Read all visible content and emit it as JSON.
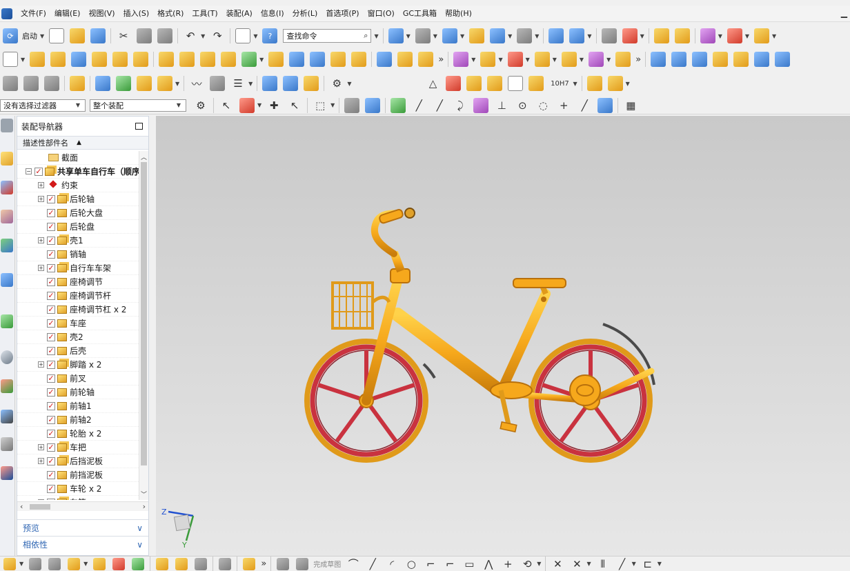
{
  "menubar": {
    "items": [
      "文件(F)",
      "编辑(E)",
      "视图(V)",
      "插入(S)",
      "格式(R)",
      "工具(T)",
      "装配(A)",
      "信息(I)",
      "分析(L)",
      "首选项(P)",
      "窗口(O)",
      "GC工具箱",
      "帮助(H)"
    ]
  },
  "toolbar": {
    "start_label": "启动",
    "search_placeholder": "查找命令",
    "filter_label": "没有选择过滤器",
    "assembly_scope": "整个装配",
    "fit_label": "10H7"
  },
  "navigator": {
    "title": "装配导航器",
    "column_header": "描述性部件名",
    "rows": [
      {
        "label": "截面",
        "type": "folder",
        "indent": 1,
        "expand": false,
        "checked": false
      },
      {
        "label": "共享单车自行车（顺序",
        "type": "asm",
        "indent": 0,
        "expand": true,
        "expanded": true,
        "checked": true,
        "bold": true
      },
      {
        "label": "约束",
        "type": "constraint",
        "indent": 1,
        "expand": true,
        "checked": false
      },
      {
        "label": "后轮轴",
        "type": "asm",
        "indent": 1,
        "expand": true,
        "checked": true
      },
      {
        "label": "后轮大盘",
        "type": "comp",
        "indent": 1,
        "expand": false,
        "checked": true
      },
      {
        "label": "后轮盘",
        "type": "comp",
        "indent": 1,
        "expand": false,
        "checked": true
      },
      {
        "label": "壳1",
        "type": "asm",
        "indent": 1,
        "expand": true,
        "checked": true
      },
      {
        "label": "销轴",
        "type": "comp",
        "indent": 1,
        "expand": false,
        "checked": true
      },
      {
        "label": "自行车车架",
        "type": "asm",
        "indent": 1,
        "expand": true,
        "checked": true
      },
      {
        "label": "座椅调节",
        "type": "comp",
        "indent": 1,
        "expand": false,
        "checked": true
      },
      {
        "label": "座椅调节杆",
        "type": "comp",
        "indent": 1,
        "expand": false,
        "checked": true
      },
      {
        "label": "座椅调节杠 x 2",
        "type": "comp",
        "indent": 1,
        "expand": false,
        "checked": true
      },
      {
        "label": "车座",
        "type": "comp",
        "indent": 1,
        "expand": false,
        "checked": true
      },
      {
        "label": "壳2",
        "type": "comp",
        "indent": 1,
        "expand": false,
        "checked": true
      },
      {
        "label": "后壳",
        "type": "comp",
        "indent": 1,
        "expand": false,
        "checked": true
      },
      {
        "label": "脚踏 x 2",
        "type": "asm",
        "indent": 1,
        "expand": true,
        "checked": true
      },
      {
        "label": "前叉",
        "type": "comp",
        "indent": 1,
        "expand": false,
        "checked": true
      },
      {
        "label": "前轮轴",
        "type": "comp",
        "indent": 1,
        "expand": false,
        "checked": true
      },
      {
        "label": "前轴1",
        "type": "comp",
        "indent": 1,
        "expand": false,
        "checked": true
      },
      {
        "label": "前轴2",
        "type": "comp",
        "indent": 1,
        "expand": false,
        "checked": true
      },
      {
        "label": "轮胎 x 2",
        "type": "comp",
        "indent": 1,
        "expand": false,
        "checked": true
      },
      {
        "label": "车把",
        "type": "asm",
        "indent": 1,
        "expand": true,
        "checked": true
      },
      {
        "label": "后挡泥板",
        "type": "asm",
        "indent": 1,
        "expand": true,
        "checked": true
      },
      {
        "label": "前挡泥板",
        "type": "comp",
        "indent": 1,
        "expand": false,
        "checked": true
      },
      {
        "label": "车轮 x 2",
        "type": "comp",
        "indent": 1,
        "expand": false,
        "checked": true
      },
      {
        "label": "车筐",
        "type": "asm",
        "indent": 1,
        "expand": true,
        "checked": true
      }
    ],
    "preview_label": "预览",
    "dependency_label": "相依性"
  },
  "viewport": {
    "axis_x": "X",
    "axis_y": "Y",
    "axis_z": "Z",
    "colors": {
      "frame": "#f6a81c",
      "frame_dark": "#b8700c",
      "rim": "#c9323f",
      "bg_top": "#c9c9c9",
      "bg_bottom": "#e7e7e7"
    }
  },
  "bottombar": {
    "sketch_label": "完成草图"
  }
}
